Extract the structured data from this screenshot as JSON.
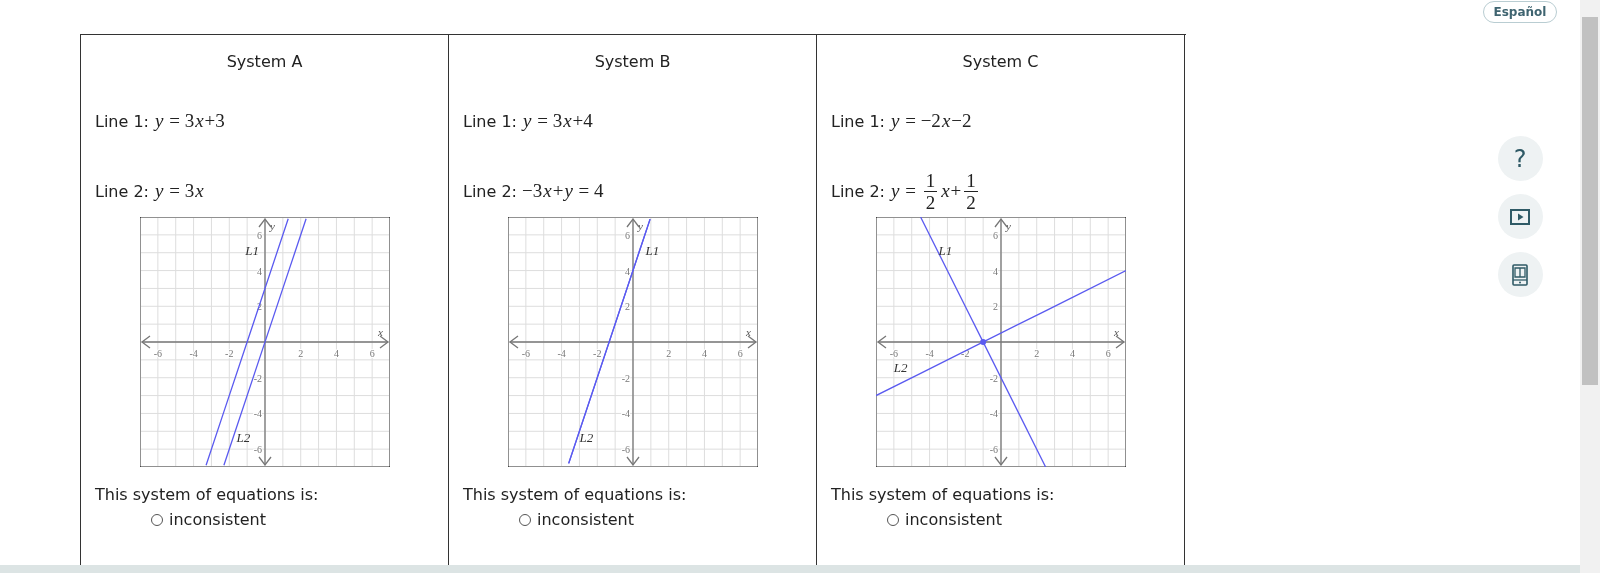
{
  "language_button": "Español",
  "tools": [
    {
      "kind": "help",
      "glyph": "?"
    },
    {
      "kind": "video"
    },
    {
      "kind": "ebook"
    }
  ],
  "systems": [
    {
      "title": "System A",
      "lines": [
        {
          "label": "Line 1:",
          "equation": [
            {
              "kind": "var",
              "text": "y"
            },
            {
              "kind": "text",
              "text": " = 3"
            },
            {
              "kind": "var",
              "text": "x"
            },
            {
              "kind": "text",
              "text": "+3"
            }
          ]
        },
        {
          "label": "Line 2:",
          "equation": [
            {
              "kind": "var",
              "text": "y"
            },
            {
              "kind": "text",
              "text": " = 3"
            },
            {
              "kind": "var",
              "text": "x"
            }
          ]
        }
      ],
      "chart_data": {
        "type": "line",
        "xlabel": "x",
        "ylabel": "y",
        "xlim": [
          -7,
          7
        ],
        "ylim": [
          -7,
          7
        ],
        "xticks": [
          -6,
          -4,
          -2,
          2,
          4,
          6
        ],
        "yticks": [
          -6,
          -4,
          -2,
          2,
          4,
          6
        ],
        "grid": true,
        "x": [
          -3.3,
          -2.3,
          1.3,
          2.3
        ],
        "series": [
          {
            "name": "L1",
            "color": "#5a5af0",
            "values": [
              -6.9,
              -3.9,
              6.9,
              null
            ]
          },
          {
            "name": "L2",
            "color": "#5a5af0",
            "values": [
              null,
              -6.9,
              3.9,
              6.9
            ]
          }
        ]
      },
      "question": "This system of equations is:",
      "options": [
        {
          "label": "inconsistent",
          "selected": false
        }
      ]
    },
    {
      "title": "System B",
      "lines": [
        {
          "label": "Line 1:",
          "equation": [
            {
              "kind": "var",
              "text": "y"
            },
            {
              "kind": "text",
              "text": " = 3"
            },
            {
              "kind": "var",
              "text": "x"
            },
            {
              "kind": "text",
              "text": "+4"
            }
          ]
        },
        {
          "label": "Line 2:",
          "equation": [
            {
              "kind": "text",
              "text": "−3"
            },
            {
              "kind": "var",
              "text": "x"
            },
            {
              "kind": "text",
              "text": "+"
            },
            {
              "kind": "var",
              "text": "y"
            },
            {
              "kind": "text",
              "text": " = 4"
            }
          ]
        }
      ],
      "chart_data": {
        "type": "line",
        "xlabel": "x",
        "ylabel": "y",
        "xlim": [
          -7,
          7
        ],
        "ylim": [
          -7,
          7
        ],
        "xticks": [
          -6,
          -4,
          -2,
          2,
          4,
          6
        ],
        "yticks": [
          -6,
          -4,
          -2,
          2,
          4,
          6
        ],
        "grid": true,
        "x": [
          -3.6,
          0.96
        ],
        "series": [
          {
            "name": "L1",
            "color": "#5a5af0",
            "values": [
              -6.8,
              6.88
            ]
          },
          {
            "name": "L2",
            "color": "#5a5af0",
            "values": [
              -6.8,
              6.88
            ]
          }
        ]
      },
      "question": "This system of equations is:",
      "options": [
        {
          "label": "inconsistent",
          "selected": false
        }
      ]
    },
    {
      "title": "System C",
      "lines": [
        {
          "label": "Line 1:",
          "equation": [
            {
              "kind": "var",
              "text": "y"
            },
            {
              "kind": "text",
              "text": " = −2"
            },
            {
              "kind": "var",
              "text": "x"
            },
            {
              "kind": "text",
              "text": "−2"
            }
          ]
        },
        {
          "label": "Line 2:",
          "equation": [
            {
              "kind": "var",
              "text": "y"
            },
            {
              "kind": "text",
              "text": " = "
            },
            {
              "kind": "frac",
              "num": "1",
              "den": "2"
            },
            {
              "kind": "var",
              "text": "x"
            },
            {
              "kind": "text",
              "text": "+"
            },
            {
              "kind": "frac",
              "num": "1",
              "den": "2"
            }
          ]
        }
      ],
      "chart_data": {
        "type": "line",
        "xlabel": "x",
        "ylabel": "y",
        "xlim": [
          -7,
          7
        ],
        "ylim": [
          -7,
          7
        ],
        "xticks": [
          -6,
          -4,
          -2,
          2,
          4,
          6
        ],
        "yticks": [
          -6,
          -4,
          -2,
          2,
          4,
          6
        ],
        "grid": true,
        "x": [
          -7,
          -4.5,
          2.5,
          7
        ],
        "series": [
          {
            "name": "L1",
            "color": "#5a5af0",
            "values": [
              null,
              7,
              -7,
              null
            ]
          },
          {
            "name": "L2",
            "color": "#5a5af0",
            "values": [
              -3,
              -1.75,
              1.75,
              4
            ]
          }
        ]
      },
      "question": "This system of equations is:",
      "options": [
        {
          "label": "inconsistent",
          "selected": false
        }
      ]
    }
  ]
}
